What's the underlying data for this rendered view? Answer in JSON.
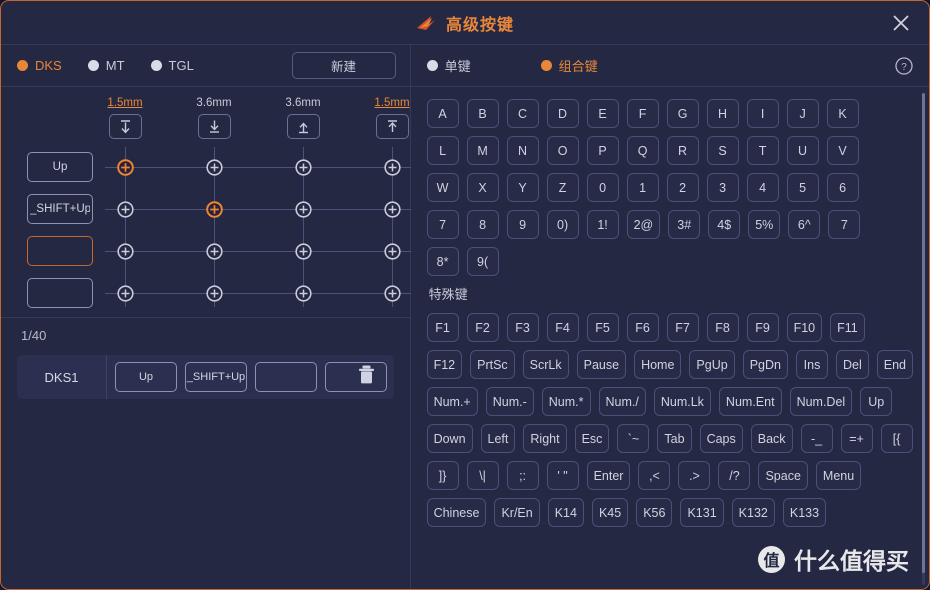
{
  "window": {
    "title": "高级按键",
    "close_label": "✕",
    "logo_icon": "brand-wing-icon",
    "accent_color": "#e8873a",
    "border_color": "#c4682c",
    "background": "#242842"
  },
  "left_toolbar": {
    "modes": [
      {
        "label": "DKS",
        "selected": true
      },
      {
        "label": "MT",
        "selected": false
      },
      {
        "label": "TGL",
        "selected": false
      }
    ],
    "new_button": "新建"
  },
  "matrix": {
    "columns": [
      {
        "mm": "1.5mm",
        "highlight": true,
        "icon": "arrow-down-from-bar-icon"
      },
      {
        "mm": "3.6mm",
        "highlight": false,
        "icon": "arrow-down-to-bar-icon"
      },
      {
        "mm": "3.6mm",
        "highlight": false,
        "icon": "arrow-up-from-bar-icon"
      },
      {
        "mm": "1.5mm",
        "highlight": true,
        "icon": "arrow-up-to-bar-icon"
      }
    ],
    "rows": [
      {
        "value": "Up",
        "focused": false
      },
      {
        "value": "_SHIFT+Up",
        "focused": false
      },
      {
        "value": "",
        "focused": true
      },
      {
        "value": "",
        "focused": false
      }
    ],
    "active_nodes": [
      {
        "row": 0,
        "col": 0
      },
      {
        "row": 1,
        "col": 1
      }
    ]
  },
  "list": {
    "counter": "1/40",
    "rows": [
      {
        "name": "DKS1",
        "slots": [
          "Up",
          "_SHIFT+Up",
          "",
          ""
        ],
        "delete_icon": "trash-icon"
      }
    ]
  },
  "right_toolbar": {
    "modes": [
      {
        "label": "单键",
        "selected": false
      },
      {
        "label": "组合键",
        "selected": true
      }
    ],
    "help_icon": "question-circle-icon"
  },
  "keypad": {
    "main_rows": [
      [
        "A",
        "B",
        "C",
        "D",
        "E",
        "F",
        "G",
        "H",
        "I",
        "J",
        "K"
      ],
      [
        "L",
        "M",
        "N",
        "O",
        "P",
        "Q",
        "R",
        "S",
        "T",
        "U",
        "V"
      ],
      [
        "W",
        "X",
        "Y",
        "Z",
        "0",
        "1",
        "2",
        "3",
        "4",
        "5",
        "6"
      ],
      [
        "7",
        "8",
        "9",
        "0)",
        "1!",
        "2@",
        "3#",
        "4$",
        "5%",
        "6^",
        "7"
      ],
      [
        "8*",
        "9("
      ]
    ],
    "special_title": "特殊键",
    "special_rows": [
      [
        "F1",
        "F2",
        "F3",
        "F4",
        "F5",
        "F6",
        "F7",
        "F8",
        "F9",
        "F10",
        "F11"
      ],
      [
        "F12",
        "PrtSc",
        "ScrLk",
        "Pause",
        "Home",
        "PgUp",
        "PgDn",
        "Ins",
        "Del",
        "End"
      ],
      [
        "Num.+",
        "Num.-",
        "Num.*",
        "Num./",
        "Num.Lk",
        "Num.Ent",
        "Num.Del",
        "Up"
      ],
      [
        "Down",
        "Left",
        "Right",
        "Esc",
        "`~",
        "Tab",
        "Caps",
        "Back",
        "-_",
        "=+",
        "[{"
      ],
      [
        "]}",
        "\\|",
        ";:",
        "' \"",
        "Enter",
        ",<",
        ".>",
        "/?",
        "Space",
        "Menu"
      ],
      [
        "Chinese",
        "Kr/En",
        "K14",
        "K45",
        "K56",
        "K131",
        "K132",
        "K133"
      ]
    ]
  },
  "watermark": {
    "logo_char": "值",
    "text": "什么值得买"
  }
}
